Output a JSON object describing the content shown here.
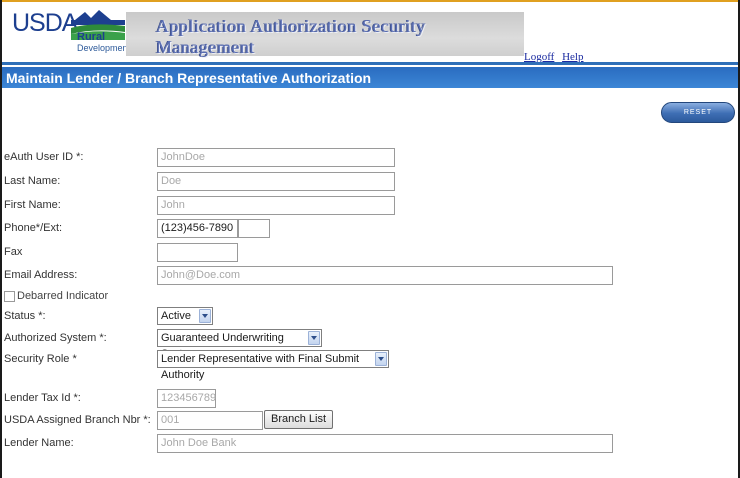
{
  "header": {
    "logo": {
      "usda": "USDA",
      "rural": "Rural",
      "development": "Development"
    },
    "banner_title": "Application Authorization Security Management",
    "links": {
      "logoff": "Logoff",
      "help": "Help"
    }
  },
  "page_title": "Maintain Lender / Branch Representative Authorization",
  "reset_label": "RESET",
  "form": {
    "eauth_user_id": {
      "label": "eAuth User ID *:",
      "value": "JohnDoe"
    },
    "last_name": {
      "label": "Last Name:",
      "value": "Doe"
    },
    "first_name": {
      "label": "First Name:",
      "value": "John"
    },
    "phone": {
      "label": "Phone*/Ext:",
      "value": "(123)456-7890",
      "ext": ""
    },
    "fax": {
      "label": "Fax",
      "value": ""
    },
    "email": {
      "label": "Email Address:",
      "value": "John@Doe.com"
    },
    "debarred": {
      "label": "Debarred Indicator",
      "checked": false
    },
    "status": {
      "label": "Status *:",
      "value": "Active"
    },
    "authorized_system": {
      "label": "Authorized System *:",
      "value": "Guaranteed Underwriting System"
    },
    "security_role": {
      "label": "Security Role *",
      "value": "Lender Representative with Final Submit Authority"
    },
    "lender_tax_id": {
      "label": "Lender Tax Id *:",
      "value": "123456789"
    },
    "branch_nbr": {
      "label": "USDA Assigned Branch Nbr *:",
      "value": "001",
      "button": "Branch List"
    },
    "lender_name": {
      "label": "Lender Name:",
      "value": "John Doe Bank"
    }
  },
  "colors": {
    "header_blue": "#2e6fb8",
    "banner_text": "#5b6fb3",
    "link": "#1a2aa0",
    "accent_orange": "#e0a020"
  }
}
